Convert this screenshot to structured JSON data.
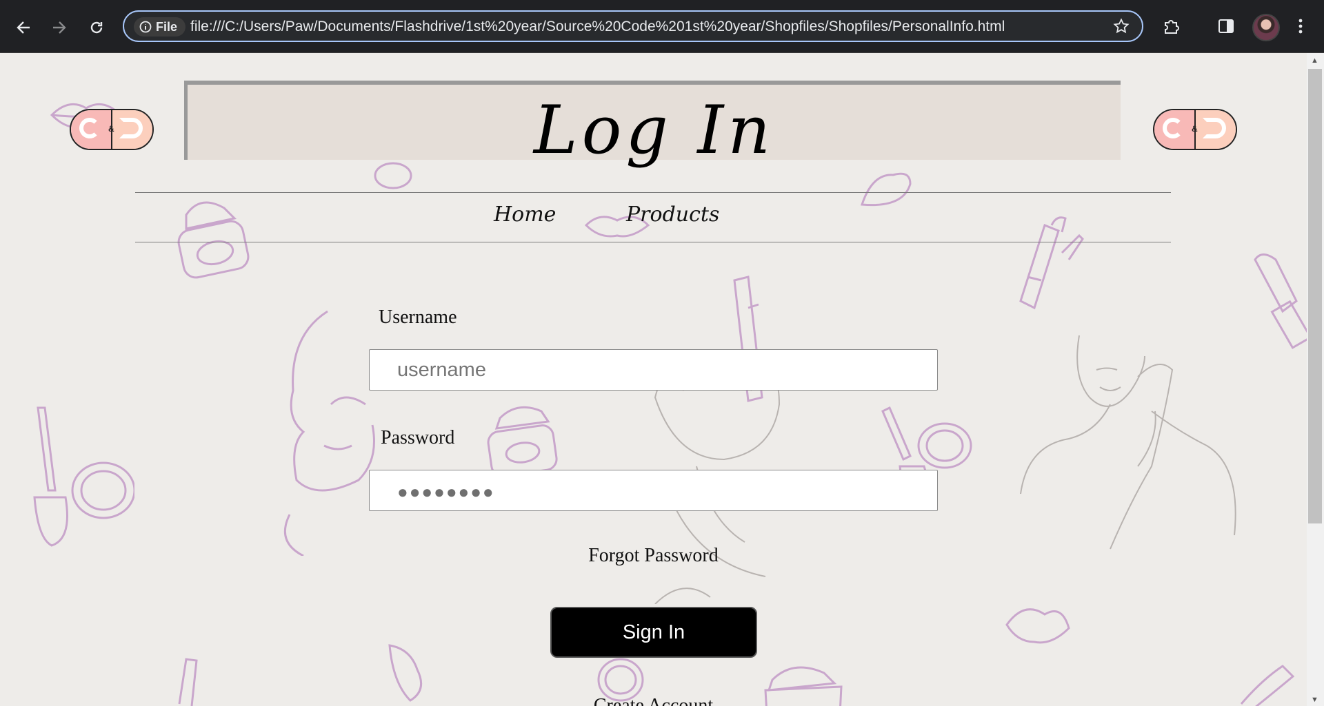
{
  "browser": {
    "chip_label": "File",
    "url": "file:///C:/Users/Paw/Documents/Flashdrive/1st%20year/Source%20Code%201st%20year/Shopfiles/Shopfiles/PersonalInfo.html"
  },
  "header": {
    "title": "Log In"
  },
  "nav": {
    "items": [
      {
        "label": "Home"
      },
      {
        "label": "Products"
      }
    ]
  },
  "form": {
    "username_label": "Username",
    "username_placeholder": "username",
    "password_label": "Password",
    "password_mask": "●●●●●●●●",
    "forgot_label": "Forgot Password",
    "signin_label": "Sign In",
    "create_label": "Create Account"
  },
  "colors": {
    "page_bg": "#eeece9",
    "title_box": "#e5ded8",
    "decor_stroke": "#c9a6cc",
    "button_bg": "#000000"
  }
}
